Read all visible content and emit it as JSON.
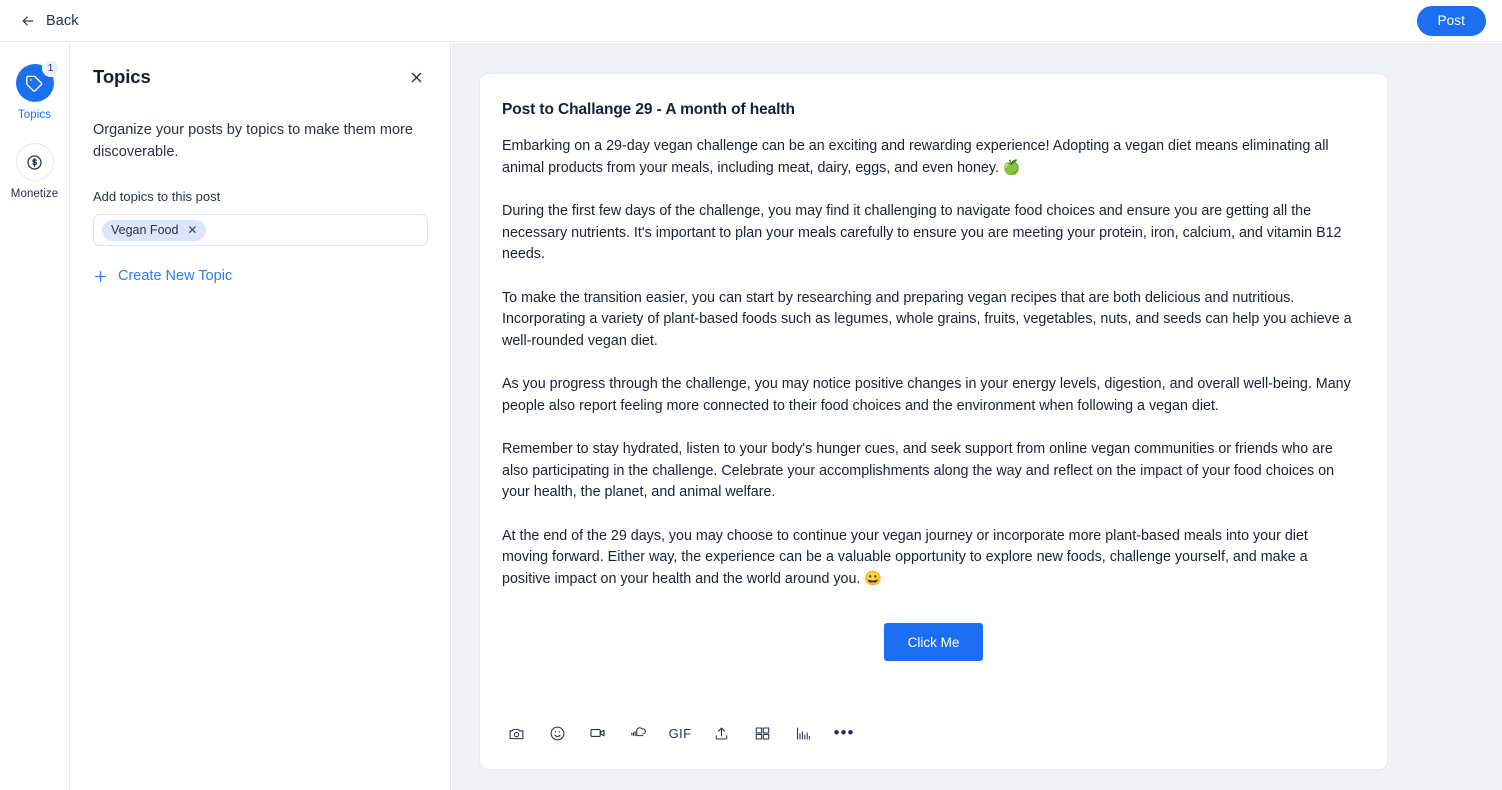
{
  "topbar": {
    "back_label": "Back",
    "back_icon": "arrow-left-icon",
    "post_label": "Post",
    "accent_color": "#1d6ff2"
  },
  "rail": {
    "items": [
      {
        "label": "Topics",
        "icon": "tag-icon",
        "badge": "1",
        "active": true
      },
      {
        "label": "Monetize",
        "icon": "dollar-circle-icon",
        "badge": "",
        "active": false
      }
    ]
  },
  "panel": {
    "title": "Topics",
    "close_icon": "close-icon",
    "description": "Organize your posts by topics to make them more discoverable.",
    "field_label": "Add topics to this post",
    "chips": [
      {
        "label": "Vegan Food",
        "remove_icon": "close-small-icon",
        "bg": "#dde5fb"
      }
    ],
    "create_topic": {
      "label": "Create New Topic",
      "icon": "plus-icon",
      "color": "#2d7bf4"
    }
  },
  "post_card": {
    "title": "Post to Challange 29 - A month of health",
    "paragraphs": [
      "Embarking on a 29-day vegan challenge can be an exciting and rewarding experience! Adopting a vegan diet means eliminating all animal products from your meals, including meat, dairy, eggs, and even honey. 🍏",
      "During the first few days of the challenge, you may find it challenging to navigate food choices and ensure you are getting all the necessary nutrients. It's important to plan your meals carefully to ensure you are meeting your protein, iron, calcium, and vitamin B12 needs.",
      "To make the transition easier, you can start by researching and preparing vegan recipes that are both delicious and nutritious. Incorporating a variety of plant-based foods such as legumes, whole grains, fruits, vegetables, nuts, and seeds can help you achieve a well-rounded vegan diet.",
      "As you progress through the challenge, you may notice positive changes in your energy levels, digestion, and overall well-being. Many people also report feeling more connected to their food choices and the environment when following a vegan diet.",
      "Remember to stay hydrated, listen to your body's hunger cues, and seek support from online vegan communities or friends who are also participating in the challenge. Celebrate your accomplishments along the way and reflect on the impact of your food choices on your health, the planet, and animal welfare.",
      "At the end of the 29 days, you may choose to continue your vegan journey or incorporate more plant-based meals into your diet moving forward. Either way, the experience can be a valuable opportunity to explore new foods, challenge yourself, and make a positive impact on your health and the world around you. 😀"
    ],
    "cta_label": "Click Me",
    "toolbar": [
      {
        "name": "camera-icon",
        "label": ""
      },
      {
        "name": "emoji-icon",
        "label": ""
      },
      {
        "name": "video-icon",
        "label": ""
      },
      {
        "name": "soundcloud-icon",
        "label": ""
      },
      {
        "name": "gif-icon",
        "label": "GIF"
      },
      {
        "name": "upload-icon",
        "label": ""
      },
      {
        "name": "embed-grid-icon",
        "label": ""
      },
      {
        "name": "poll-chart-icon",
        "label": ""
      },
      {
        "name": "more-options-icon",
        "label": "•••"
      }
    ]
  }
}
